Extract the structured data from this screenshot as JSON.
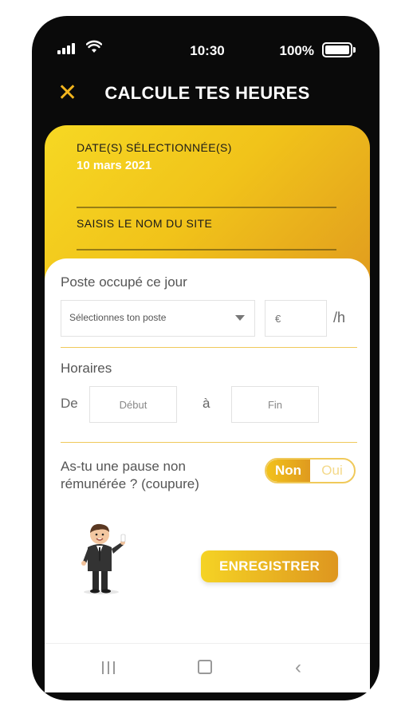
{
  "status_bar": {
    "time": "10:30",
    "battery": "100%"
  },
  "header": {
    "title": "CALCULE TES HEURES",
    "close_icon": "close-icon"
  },
  "selection": {
    "date_label": "DATE(S) SÉLECTIONNÉE(S)",
    "date_value": "10 mars 2021",
    "site_placeholder": "SAISIS LE NOM DU SITE"
  },
  "position": {
    "label": "Poste occupé ce jour",
    "select_placeholder": "Sélectionnes ton poste",
    "rate_placeholder": "€",
    "rate_unit": "/h"
  },
  "schedule": {
    "label": "Horaires",
    "from_label": "De",
    "start_placeholder": "Début",
    "to_label": "à",
    "end_placeholder": "Fin"
  },
  "pause": {
    "question": "As-tu une pause non rémunérée ? (coupure)",
    "option_no": "Non",
    "option_yes": "Oui",
    "selected": "Non"
  },
  "actions": {
    "save_label": "ENREGISTRER"
  },
  "colors": {
    "accent_gold": "#f2c21b",
    "accent_orange": "#de961f",
    "phone_frame": "#0a0a0a"
  }
}
